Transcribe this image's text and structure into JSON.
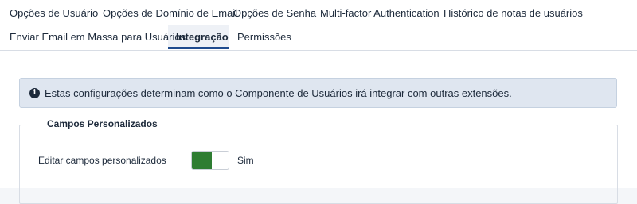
{
  "tabs": [
    {
      "label": "Opções de Usuário",
      "active": false
    },
    {
      "label": "Opções de Domínio de Email",
      "active": false
    },
    {
      "label": "Opções de Senha",
      "active": false
    },
    {
      "label": "Multi-factor Authentication",
      "active": false
    },
    {
      "label": "Histórico de notas de usuários",
      "active": false
    },
    {
      "label": "Enviar Email em Massa para Usuários",
      "active": false
    },
    {
      "label": "Integração",
      "active": true
    },
    {
      "label": "Permissões",
      "active": false
    }
  ],
  "alert": {
    "icon": "info-circle-icon",
    "text": "Estas configurações determinam como o Componente de Usuários irá integrar com outras extensões."
  },
  "fieldset": {
    "legend": "Campos Personalizados",
    "field": {
      "label": "Editar campos personalizados",
      "value": "Sim",
      "on": true,
      "on_color": "#2e7d32"
    }
  },
  "colors": {
    "accent": "#1f4b8e",
    "alert_bg": "#dfe6f0"
  }
}
